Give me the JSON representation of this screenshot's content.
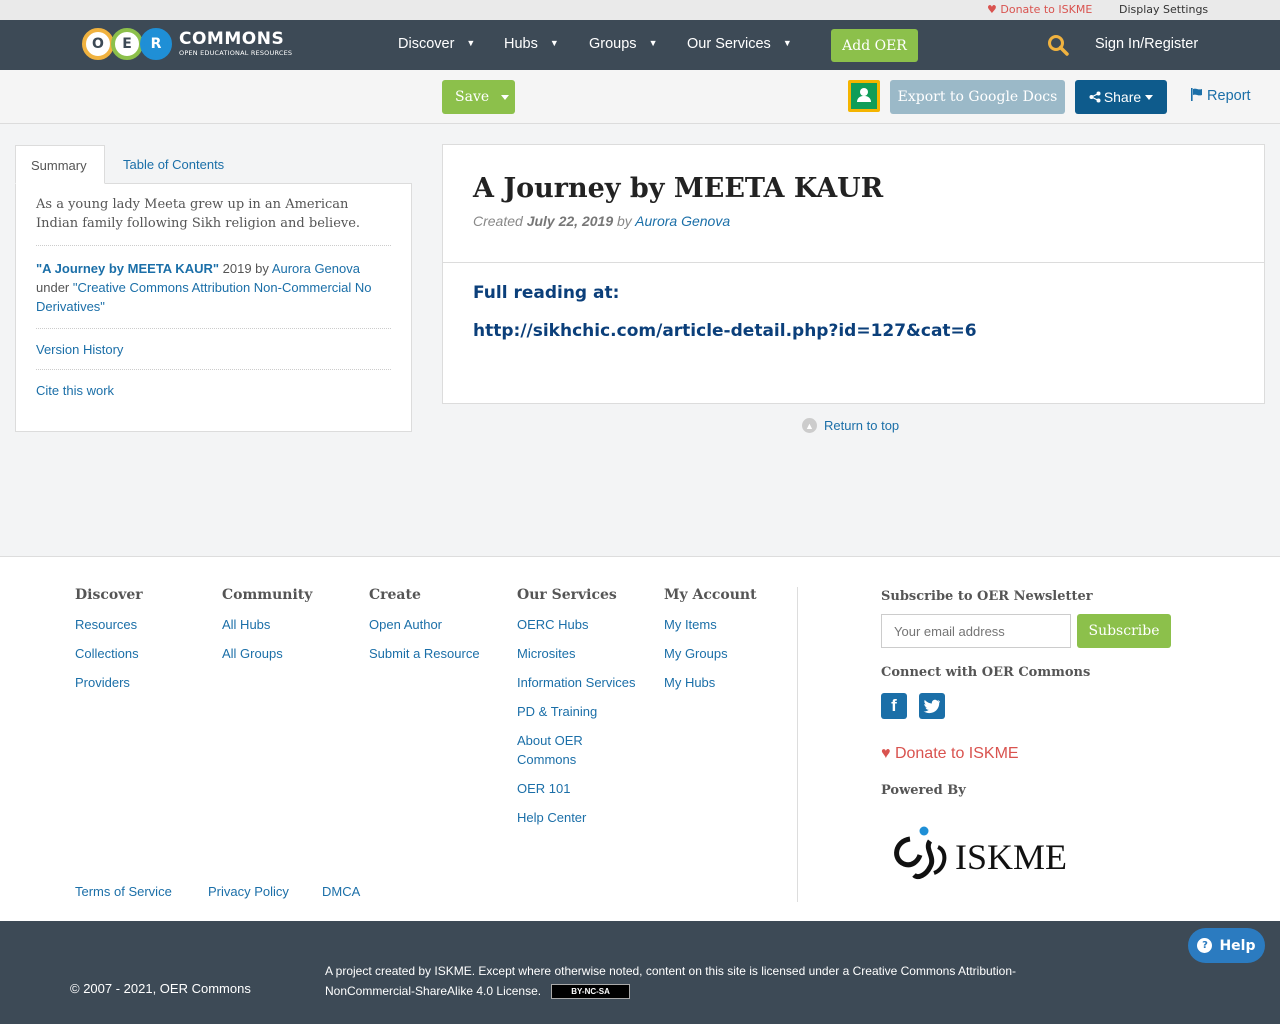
{
  "util": {
    "donate": "Donate to ISKME",
    "display_settings": "Display Settings"
  },
  "nav": {
    "logo_letters": [
      "O",
      "E",
      "R"
    ],
    "logo_big": "COMMONS",
    "logo_small": "OPEN EDUCATIONAL RESOURCES",
    "items": [
      "Discover",
      "Hubs",
      "Groups",
      "Our Services"
    ],
    "add_oer": "Add OER",
    "sign_in": "Sign In/Register"
  },
  "toolbar": {
    "save": "Save",
    "export": "Export to Google Docs",
    "share": "Share",
    "report": "Report"
  },
  "left_panel": {
    "tabs": [
      "Summary",
      "Table of Contents"
    ],
    "description": "As a young lady Meeta grew up in an American Indian family following Sikh religion and believe.",
    "attr_title": "\"A Journey by MEETA KAUR\"",
    "attr_year": " 2019 by ",
    "attr_author": "Aurora Genova",
    "attr_under": " under ",
    "attr_license": "\"Creative Commons Attribution Non-Commercial No Derivatives\"",
    "version_history": "Version History",
    "cite": "Cite this work"
  },
  "main": {
    "title": "A Journey by MEETA KAUR",
    "created": "Created",
    "date": "July 22, 2019",
    "by": "by",
    "author": "Aurora Genova",
    "full_reading": "Full reading at:",
    "url": "http://sikhchic.com/article-detail.php?id=127&cat=6",
    "return_top": "Return to top"
  },
  "footer": {
    "columns": [
      {
        "title": "Discover",
        "links": [
          "Resources",
          "Collections",
          "Providers"
        ]
      },
      {
        "title": "Community",
        "links": [
          "All Hubs",
          "All Groups"
        ]
      },
      {
        "title": "Create",
        "links": [
          "Open Author",
          "Submit a Resource"
        ]
      },
      {
        "title": "Our Services",
        "links": [
          "OERC Hubs",
          "Microsites",
          "Information Services",
          "PD & Training",
          "About OER Commons",
          "OER 101",
          "Help Center"
        ]
      },
      {
        "title": "My Account",
        "links": [
          "My Items",
          "My Groups",
          "My Hubs"
        ]
      }
    ],
    "newsletter_title": "Subscribe to OER Newsletter",
    "email_placeholder": "Your email address",
    "subscribe": "Subscribe",
    "connect": "Connect with OER Commons",
    "social": [
      "facebook-icon",
      "twitter-icon"
    ],
    "donate": "Donate to ISKME",
    "powered_by": "Powered By",
    "iskme_logo_text": "ISKME",
    "bottom_links": [
      "Terms of Service",
      "Privacy Policy",
      "DMCA"
    ]
  },
  "bottom": {
    "copyright": "© 2007 - 2021, OER Commons",
    "license": "A project created by ISKME. Except where otherwise noted, content on this site is licensed under a Creative Commons Attribution-NonCommercial-ShareAlike 4.0 License.",
    "cc_badge": "BY-NC-SA",
    "help": "Help"
  },
  "colors": {
    "nav_bg": "#3d4a56",
    "accent_green": "#8cc04b",
    "link_blue": "#1b6fa8",
    "share_blue": "#0e5b8c",
    "donate_red": "#d9534f"
  }
}
